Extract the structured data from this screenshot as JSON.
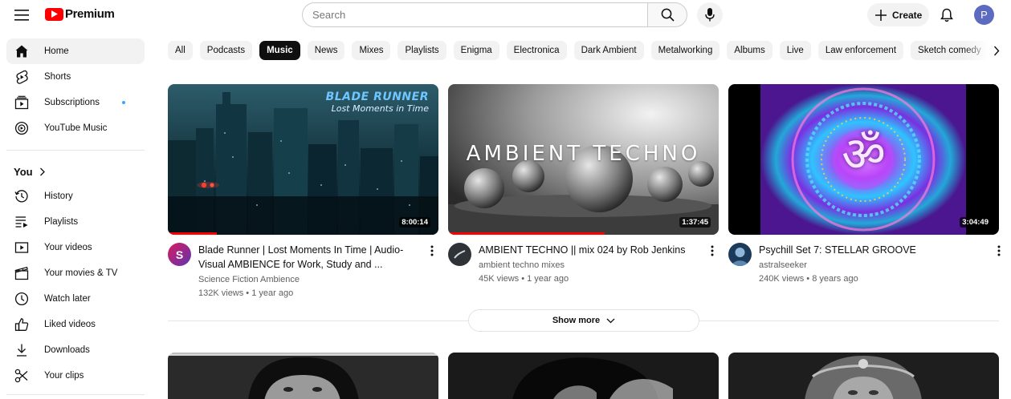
{
  "brand": {
    "name": "Premium"
  },
  "search": {
    "placeholder": "Search"
  },
  "header": {
    "create_label": "Create",
    "avatar_letter": "P"
  },
  "sidebar": {
    "items": [
      {
        "label": "Home",
        "icon": "home-icon"
      },
      {
        "label": "Shorts",
        "icon": "shorts-icon"
      },
      {
        "label": "Subscriptions",
        "icon": "subscriptions-icon"
      },
      {
        "label": "YouTube Music",
        "icon": "youtube-music-icon"
      }
    ],
    "you_label": "You",
    "you_items": [
      {
        "label": "History",
        "icon": "history-icon"
      },
      {
        "label": "Playlists",
        "icon": "playlists-icon"
      },
      {
        "label": "Your videos",
        "icon": "your-videos-icon"
      },
      {
        "label": "Your movies & TV",
        "icon": "movies-icon"
      },
      {
        "label": "Watch later",
        "icon": "clock-icon"
      },
      {
        "label": "Liked videos",
        "icon": "thumbs-up-icon"
      },
      {
        "label": "Downloads",
        "icon": "download-icon"
      },
      {
        "label": "Your clips",
        "icon": "scissors-icon"
      }
    ]
  },
  "chips": [
    "All",
    "Podcasts",
    "Music",
    "News",
    "Mixes",
    "Playlists",
    "Enigma",
    "Electronica",
    "Dark Ambient",
    "Metalworking",
    "Albums",
    "Live",
    "Law enforcement",
    "Sketch comedy"
  ],
  "active_chip": "Music",
  "videos": [
    {
      "title": "Blade Runner | Lost Moments In Time | Audio-Visual AMBIENCE for Work, Study and ...",
      "channel": "Science Fiction Ambience",
      "stats": "132K views • 1 year ago",
      "duration": "8:00:14",
      "thumb_text_1": "BLADE RUNNER",
      "thumb_text_2": "Lost Moments in Time",
      "avatar_letter": "S",
      "watched_fraction": 0.18
    },
    {
      "title": "AMBIENT TECHNO || mix 024 by Rob Jenkins",
      "channel": "ambient techno mixes",
      "stats": "45K views • 1 year ago",
      "duration": "1:37:45",
      "thumb_text_1": "AMBIENT TECHNO",
      "watched_fraction": 0.58
    },
    {
      "title": "Psychill Set 7: STELLAR GROOVE",
      "channel": "astralseeker",
      "stats": "240K views • 8 years ago",
      "duration": "3:04:49",
      "thumb_text_1": "ॐ"
    }
  ],
  "show_more_label": "Show more",
  "colors": {
    "brand_red": "#ff0000",
    "progress_red": "#ff0000",
    "active_chip_bg": "#0f0f0f",
    "unread_dot": "#3ea6ff"
  }
}
